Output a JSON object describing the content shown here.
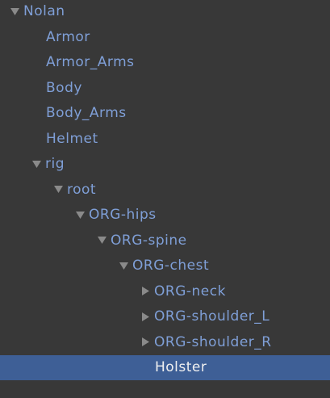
{
  "hierarchy": {
    "items": [
      {
        "label": "Nolan",
        "depth": 0,
        "state": "expanded",
        "selected": false
      },
      {
        "label": "Armor",
        "depth": 1,
        "state": "leaf",
        "selected": false
      },
      {
        "label": "Armor_Arms",
        "depth": 1,
        "state": "leaf",
        "selected": false
      },
      {
        "label": "Body",
        "depth": 1,
        "state": "leaf",
        "selected": false
      },
      {
        "label": "Body_Arms",
        "depth": 1,
        "state": "leaf",
        "selected": false
      },
      {
        "label": "Helmet",
        "depth": 1,
        "state": "leaf",
        "selected": false
      },
      {
        "label": "rig",
        "depth": 1,
        "state": "expanded",
        "selected": false
      },
      {
        "label": "root",
        "depth": 2,
        "state": "expanded",
        "selected": false
      },
      {
        "label": "ORG-hips",
        "depth": 3,
        "state": "expanded",
        "selected": false
      },
      {
        "label": "ORG-spine",
        "depth": 4,
        "state": "expanded",
        "selected": false
      },
      {
        "label": "ORG-chest",
        "depth": 5,
        "state": "expanded",
        "selected": false
      },
      {
        "label": "ORG-neck",
        "depth": 6,
        "state": "collapsed",
        "selected": false
      },
      {
        "label": "ORG-shoulder_L",
        "depth": 6,
        "state": "collapsed",
        "selected": false
      },
      {
        "label": "ORG-shoulder_R",
        "depth": 6,
        "state": "collapsed",
        "selected": false
      },
      {
        "label": "Holster",
        "depth": 6,
        "state": "leaf",
        "selected": true
      }
    ]
  },
  "colors": {
    "background": "#383838",
    "label_text": "#7f9fd7",
    "selected_row": "#3e5f96",
    "selected_text": "#f0f0f0",
    "arrow": "#8a8a8a"
  }
}
